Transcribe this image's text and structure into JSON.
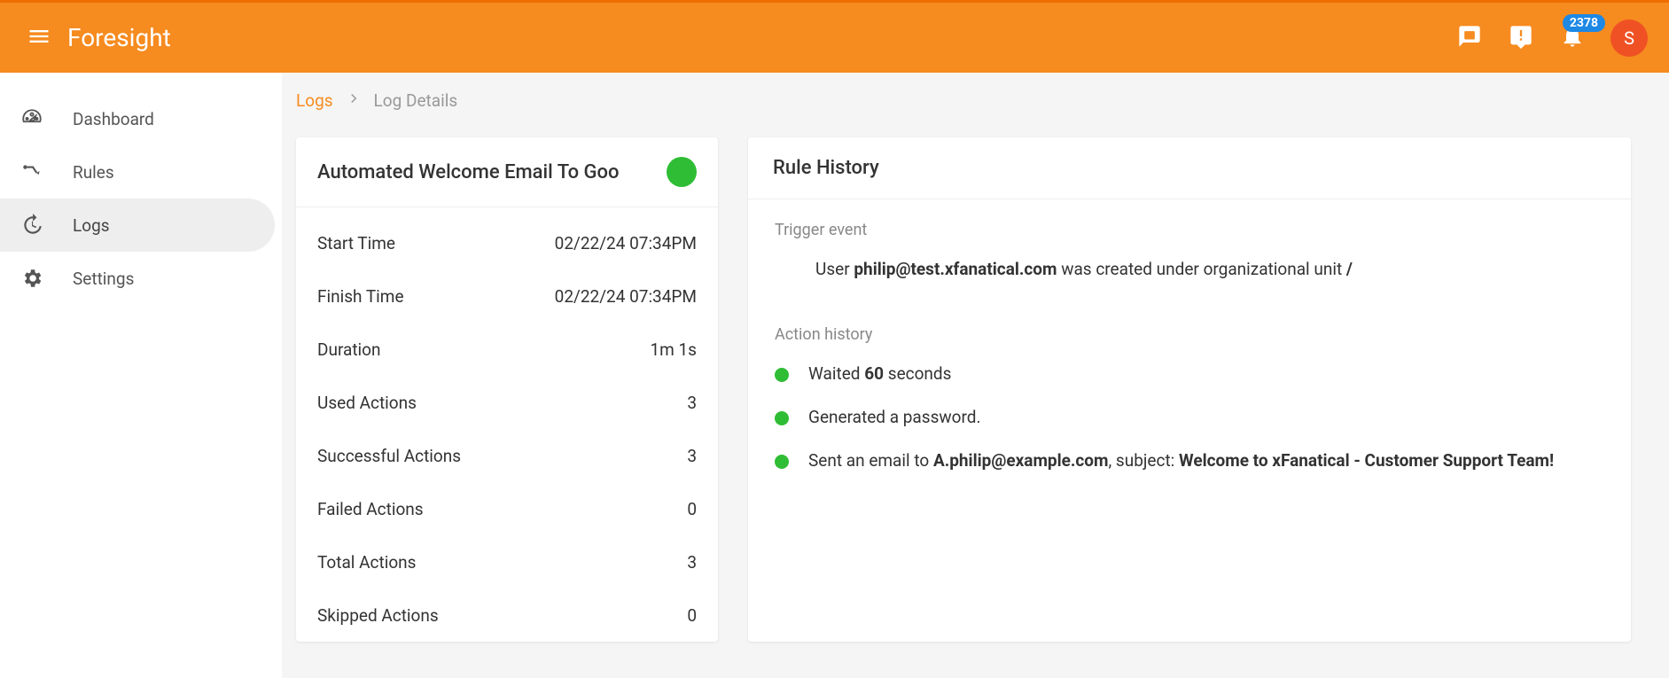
{
  "header": {
    "brand": "Foresight",
    "badge": "2378",
    "avatar_initial": "S"
  },
  "sidebar": {
    "items": [
      {
        "label": "Dashboard"
      },
      {
        "label": "Rules"
      },
      {
        "label": "Logs"
      },
      {
        "label": "Settings"
      }
    ]
  },
  "breadcrumbs": {
    "root": "Logs",
    "current": "Log Details"
  },
  "details": {
    "title": "Automated Welcome Email To Goo",
    "rows": [
      {
        "label": "Start Time",
        "value": "02/22/24 07:34PM"
      },
      {
        "label": "Finish Time",
        "value": "02/22/24 07:34PM"
      },
      {
        "label": "Duration",
        "value": "1m 1s"
      },
      {
        "label": "Used Actions",
        "value": "3"
      },
      {
        "label": "Successful Actions",
        "value": "3"
      },
      {
        "label": "Failed Actions",
        "value": "0"
      },
      {
        "label": "Total Actions",
        "value": "3"
      },
      {
        "label": "Skipped Actions",
        "value": "0"
      }
    ]
  },
  "history": {
    "title": "Rule History",
    "trigger_label": "Trigger event",
    "trigger": {
      "prefix": "User ",
      "user": "philip@test.xfanatical.com",
      "mid": " was created under organizational unit ",
      "unit": "/"
    },
    "action_label": "Action history",
    "actions": [
      {
        "t1": "Waited ",
        "b1": "60",
        "t2": " seconds"
      },
      {
        "t1": "Generated a password."
      },
      {
        "t1": "Sent an email to ",
        "b1": "A.philip@example.com",
        "t2": ", subject: ",
        "b2": "Welcome to xFanatical - Customer Support Team!"
      }
    ]
  }
}
